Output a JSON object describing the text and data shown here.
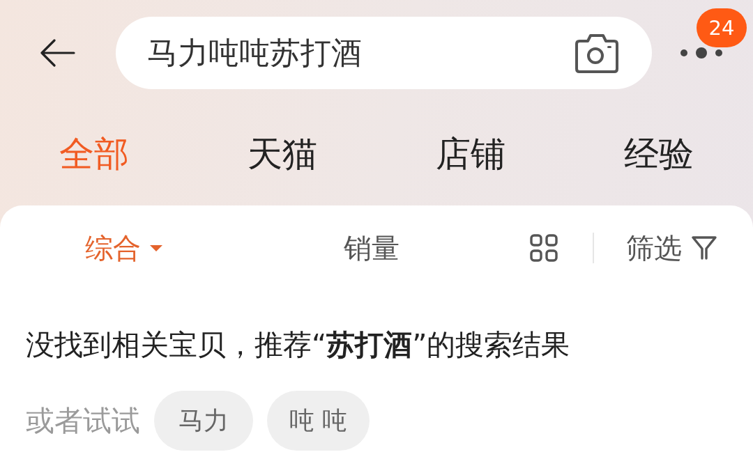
{
  "header": {
    "search": {
      "value": "马力吨吨苏打酒"
    },
    "badge": {
      "count": "24"
    }
  },
  "tabs": [
    {
      "label": "全部",
      "selected": true
    },
    {
      "label": "天猫",
      "selected": false
    },
    {
      "label": "店铺",
      "selected": false
    },
    {
      "label": "经验",
      "selected": false
    }
  ],
  "sort_options": [
    {
      "label": "综合",
      "selected": true,
      "dropdown": true
    },
    {
      "label": "销量",
      "selected": false,
      "dropdown": false
    }
  ],
  "filter": {
    "label": "筛选"
  },
  "notice": {
    "message": "没找到相关宝贝，推荐“**苏打酒**”的搜索结果",
    "suggest_label": "或者试试",
    "suggestions": [
      "马力",
      "吨 吨"
    ]
  }
}
